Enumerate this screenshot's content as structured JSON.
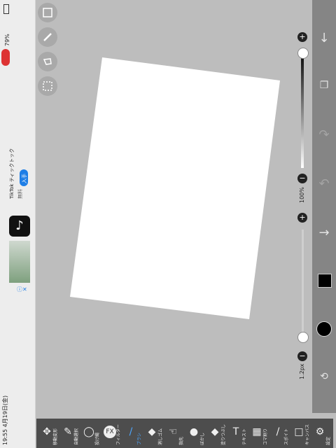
{
  "status": {
    "time_date": "19:55  4月19日(金)",
    "battery": "79%"
  },
  "ad": {
    "app_name": "TikTok ティックトック",
    "price": "無料",
    "get_button": "入手"
  },
  "left_tools": [
    "layer-icon",
    "pen-icon",
    "lasso-icon",
    "select-icon"
  ],
  "right_panel": {
    "opacity_label": "100%",
    "brush_size_label": "1.2px",
    "color_swatch": "#000000"
  },
  "bottom_tools": [
    {
      "label": "移動変形",
      "icon": "✥"
    },
    {
      "label": "自動選択",
      "icon": "✎"
    },
    {
      "label": "投げ縄",
      "icon": "◯"
    },
    {
      "label": "フィルター",
      "icon": "FX"
    },
    {
      "label": "ブラシ",
      "icon": "/"
    },
    {
      "label": "消しゴム",
      "icon": "◆"
    },
    {
      "label": "指先",
      "icon": "☜"
    },
    {
      "label": "ぼかし",
      "icon": "●"
    },
    {
      "label": "塗りつぶし",
      "icon": "◆"
    },
    {
      "label": "テキスト",
      "icon": "T"
    },
    {
      "label": "コマ割り",
      "icon": "▦"
    },
    {
      "label": "スポイト",
      "icon": "/"
    },
    {
      "label": "キャンバス",
      "icon": "□"
    },
    {
      "label": "設定",
      "icon": "⚙"
    }
  ],
  "colors": {
    "active_tool": "#4da6ff"
  }
}
